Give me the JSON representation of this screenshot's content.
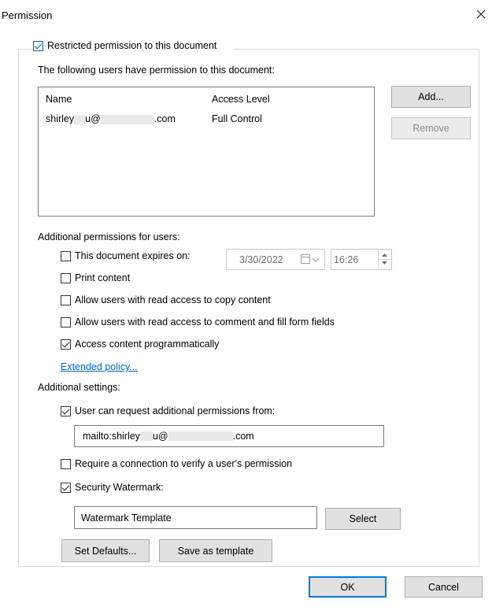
{
  "dialog": {
    "title": "Permission"
  },
  "restricted": {
    "label": "Restricted permission to this document",
    "checked": true
  },
  "users": {
    "heading": "The following users have permission to this document:",
    "columns": [
      "Name",
      "Access Level"
    ],
    "rows": [
      {
        "name": "shirley  u@  .com",
        "name_pre": "shirley",
        "name_mid": "u@",
        "name_post": ".com",
        "access": "Full Control"
      }
    ]
  },
  "buttons": {
    "add": "Add...",
    "remove": "Remove",
    "set_defaults": "Set Defaults...",
    "save_template": "Save as template",
    "ok": "OK",
    "cancel": "Cancel",
    "select": "Select"
  },
  "additional_permissions": {
    "heading": "Additional permissions for users:",
    "expires": {
      "label": "This document expires on:",
      "checked": false,
      "date": "3/30/2022",
      "time": "16:26"
    },
    "print": {
      "label": "Print content",
      "checked": false
    },
    "copy": {
      "label": "Allow users with read access to copy content",
      "checked": false
    },
    "comment": {
      "label": "Allow users with read access to comment and fill form fields",
      "checked": false
    },
    "programmatic": {
      "label": "Access content programmatically",
      "checked": true
    },
    "extended_policy": "Extended policy..."
  },
  "additional_settings": {
    "heading": "Additional settings:",
    "request": {
      "label": "User can request additional permissions from:",
      "checked": true,
      "value_pre": "mailto:shirley",
      "value_mid": "u@",
      "value_post": ".com"
    },
    "verify": {
      "label": "Require a connection to verify a user's permission",
      "checked": false
    },
    "watermark": {
      "label": "Security Watermark:",
      "checked": true,
      "template": "Watermark Template"
    }
  },
  "icons": {
    "close": "close-icon",
    "calendar": "calendar-icon",
    "spin": "spinner-arrows-icon"
  }
}
